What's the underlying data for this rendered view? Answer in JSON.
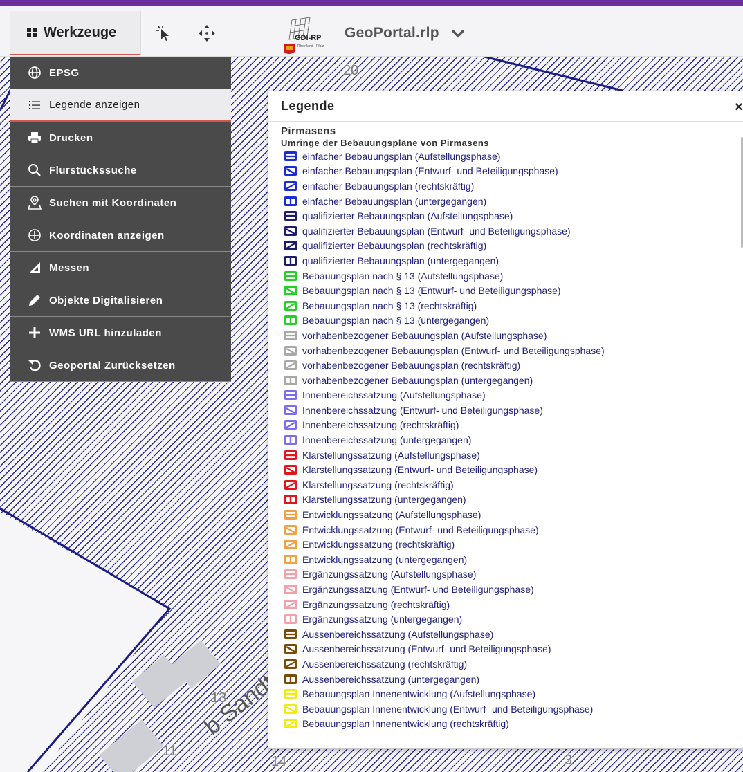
{
  "toolbar": {
    "tools_label": "Werkzeuge",
    "select_icon": "pointer-select-icon",
    "pan_icon": "move-arrows-icon",
    "logo_text": "GDI-RP",
    "logo_subtext": "Rheinland - Pfalz",
    "portal_title": "GeoPortal.rlp",
    "accent_color": "#6b2fa0"
  },
  "menu": {
    "items": [
      {
        "label": "EPSG",
        "icon": "globe-icon"
      },
      {
        "label": "Legende anzeigen",
        "icon": "list-icon"
      },
      {
        "label": "Drucken",
        "icon": "printer-icon"
      },
      {
        "label": "Flurstückssuche",
        "icon": "search-icon"
      },
      {
        "label": "Suchen mit Koordinaten",
        "icon": "map-pin-icon"
      },
      {
        "label": "Koordinaten anzeigen",
        "icon": "crosshair-icon"
      },
      {
        "label": "Messen",
        "icon": "ruler-triangle-icon"
      },
      {
        "label": "Objekte Digitalisieren",
        "icon": "pencil-icon"
      },
      {
        "label": "WMS URL hinzuladen",
        "icon": "plus-icon"
      },
      {
        "label": "Geoportal Zurücksetzen",
        "icon": "reset-icon"
      }
    ],
    "active_index": 1
  },
  "map": {
    "labels": [
      "20",
      "13",
      "11",
      "14",
      "3"
    ],
    "street_label": "b Sandt-e",
    "hatch_color": "#24238e"
  },
  "legend": {
    "title": "Legende",
    "close": "×",
    "layer": "Pirmasens",
    "sublayer": "Umringe der Bebauungspläne von Pirmasens",
    "items": [
      {
        "label": "einfacher Bebauungsplan (Aufstellungsphase)",
        "color": "#1a2bd8",
        "fill": "#ffffff",
        "phase": "aufstellung"
      },
      {
        "label": "einfacher Bebauungsplan (Entwurf- und Beteiligungsphase)",
        "color": "#1a2bd8",
        "fill": "#ffffff",
        "phase": "entwurf"
      },
      {
        "label": "einfacher Bebauungsplan (rechtskräftig)",
        "color": "#1a2bd8",
        "fill": "#ffffff",
        "phase": "rechtskraeftig"
      },
      {
        "label": "einfacher Bebauungsplan (untergegangen)",
        "color": "#1a2bd8",
        "fill": "#ffffff",
        "phase": "untergegangen"
      },
      {
        "label": "qualifizierter Bebauungsplan (Aufstellungsphase)",
        "color": "#1c1c6e",
        "fill": "#ffffff",
        "phase": "aufstellung"
      },
      {
        "label": "qualifizierter Bebauungsplan (Entwurf- und Beteiligungsphase)",
        "color": "#1c1c6e",
        "fill": "#ffffff",
        "phase": "entwurf"
      },
      {
        "label": "qualifizierter Bebauungsplan (rechtskräftig)",
        "color": "#1c1c6e",
        "fill": "#ffffff",
        "phase": "rechtskraeftig"
      },
      {
        "label": "qualifizierter Bebauungsplan (untergegangen)",
        "color": "#1c1c6e",
        "fill": "#ffffff",
        "phase": "untergegangen"
      },
      {
        "label": "Bebauungsplan nach § 13 (Aufstellungsphase)",
        "color": "#22d322",
        "fill": "#ffffff",
        "phase": "aufstellung"
      },
      {
        "label": "Bebauungsplan nach § 13 (Entwurf- und Beteiligungsphase)",
        "color": "#22d322",
        "fill": "#ffffff",
        "phase": "entwurf"
      },
      {
        "label": "Bebauungsplan nach § 13 (rechtskräftig)",
        "color": "#22d322",
        "fill": "#ffffff",
        "phase": "rechtskraeftig"
      },
      {
        "label": "Bebauungsplan nach § 13 (untergegangen)",
        "color": "#22d322",
        "fill": "#ffffff",
        "phase": "untergegangen"
      },
      {
        "label": "vorhabenbezogener Bebauungsplan (Aufstellungsphase)",
        "color": "#a8a8a8",
        "fill": "#ffffff",
        "phase": "aufstellung"
      },
      {
        "label": "vorhabenbezogener Bebauungsplan (Entwurf- und Beteiligungsphase)",
        "color": "#a8a8a8",
        "fill": "#ffffff",
        "phase": "entwurf"
      },
      {
        "label": "vorhabenbezogener Bebauungsplan (rechtskräftig)",
        "color": "#a8a8a8",
        "fill": "#ffffff",
        "phase": "rechtskraeftig"
      },
      {
        "label": "vorhabenbezogener Bebauungsplan (untergegangen)",
        "color": "#a8a8a8",
        "fill": "#ffffff",
        "phase": "untergegangen"
      },
      {
        "label": "Innenbereichssatzung (Aufstellungsphase)",
        "color": "#7b6cf0",
        "fill": "#ffffff",
        "phase": "aufstellung"
      },
      {
        "label": "Innenbereichssatzung (Entwurf- und Beteiligungsphase)",
        "color": "#7b6cf0",
        "fill": "#ffffff",
        "phase": "entwurf"
      },
      {
        "label": "Innenbereichssatzung (rechtskräftig)",
        "color": "#7b6cf0",
        "fill": "#ffffff",
        "phase": "rechtskraeftig"
      },
      {
        "label": "Innenbereichssatzung (untergegangen)",
        "color": "#7b6cf0",
        "fill": "#ffffff",
        "phase": "untergegangen"
      },
      {
        "label": "Klarstellungssatzung (Aufstellungsphase)",
        "color": "#e3141c",
        "fill": "#ffffff",
        "phase": "aufstellung"
      },
      {
        "label": "Klarstellungssatzung (Entwurf- und Beteiligungsphase)",
        "color": "#e3141c",
        "fill": "#ffffff",
        "phase": "entwurf"
      },
      {
        "label": "Klarstellungssatzung (rechtskräftig)",
        "color": "#e3141c",
        "fill": "#ffffff",
        "phase": "rechtskraeftig"
      },
      {
        "label": "Klarstellungssatzung (untergegangen)",
        "color": "#e3141c",
        "fill": "#ffffff",
        "phase": "untergegangen"
      },
      {
        "label": "Entwicklungssatzung (Aufstellungsphase)",
        "color": "#f4a040",
        "fill": "#ffffff",
        "phase": "aufstellung"
      },
      {
        "label": "Entwicklungssatzung (Entwurf- und Beteiligungsphase)",
        "color": "#f4a040",
        "fill": "#ffffff",
        "phase": "entwurf"
      },
      {
        "label": "Entwicklungssatzung (rechtskräftig)",
        "color": "#f4a040",
        "fill": "#ffffff",
        "phase": "rechtskraeftig"
      },
      {
        "label": "Entwicklungssatzung (untergegangen)",
        "color": "#f4a040",
        "fill": "#ffffff",
        "phase": "untergegangen"
      },
      {
        "label": "Ergänzungssatzung (Aufstellungsphase)",
        "color": "#f4a0a8",
        "fill": "#ffffff",
        "phase": "aufstellung"
      },
      {
        "label": "Ergänzungssatzung (Entwurf- und Beteiligungsphase)",
        "color": "#f4a0a8",
        "fill": "#ffffff",
        "phase": "entwurf"
      },
      {
        "label": "Ergänzungssatzung (rechtskräftig)",
        "color": "#f4a0a8",
        "fill": "#ffffff",
        "phase": "rechtskraeftig"
      },
      {
        "label": "Ergänzungssatzung (untergegangen)",
        "color": "#f4a0a8",
        "fill": "#ffffff",
        "phase": "untergegangen"
      },
      {
        "label": "Aussenbereichssatzung (Aufstellungsphase)",
        "color": "#7a4a08",
        "fill": "#ffffff",
        "phase": "aufstellung"
      },
      {
        "label": "Aussenbereichssatzung (Entwurf- und Beteiligungsphase)",
        "color": "#7a4a08",
        "fill": "#ffffff",
        "phase": "entwurf"
      },
      {
        "label": "Aussenbereichssatzung (rechtskräftig)",
        "color": "#7a4a08",
        "fill": "#ffffff",
        "phase": "rechtskraeftig"
      },
      {
        "label": "Aussenbereichssatzung (untergegangen)",
        "color": "#7a4a08",
        "fill": "#ffffff",
        "phase": "untergegangen"
      },
      {
        "label": "Bebauungsplan Innenentwicklung (Aufstellungsphase)",
        "color": "#f2ea10",
        "fill": "#ffffff",
        "phase": "aufstellung"
      },
      {
        "label": "Bebauungsplan Innenentwicklung (Entwurf- und Beteiligungsphase)",
        "color": "#f2ea10",
        "fill": "#ffffff",
        "phase": "entwurf"
      },
      {
        "label": "Bebauungsplan Innenentwicklung (rechtskräftig)",
        "color": "#f2ea10",
        "fill": "#ffffff",
        "phase": "rechtskraeftig"
      }
    ]
  }
}
